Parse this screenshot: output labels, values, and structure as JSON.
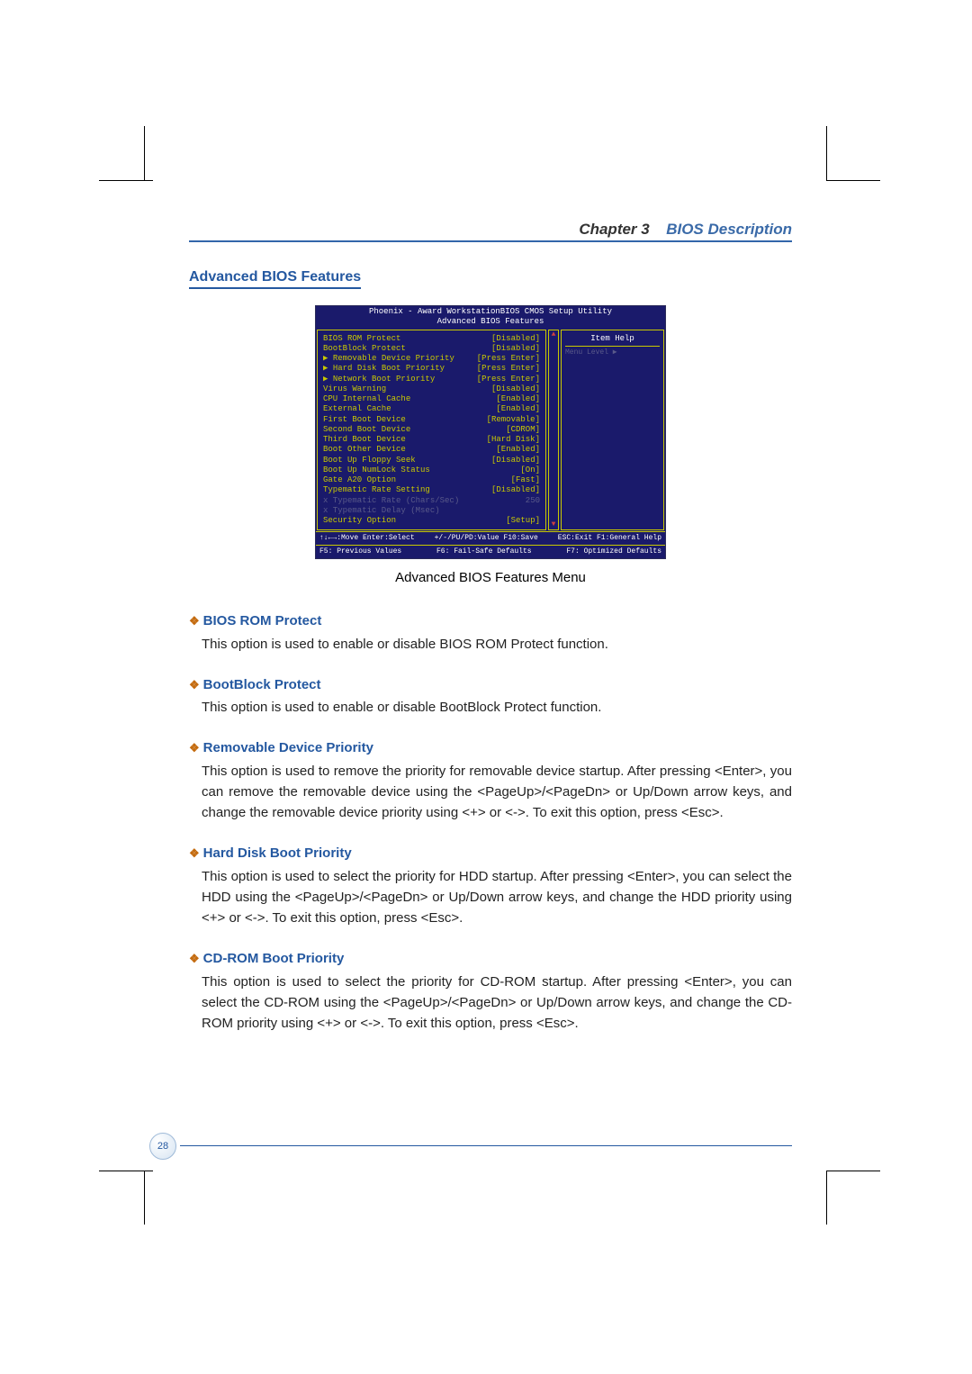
{
  "header": {
    "chapter": "Chapter 3",
    "title": "BIOS Description"
  },
  "section_title": "Advanced BIOS Features",
  "bios": {
    "title1": "Phoenix - Award WorkstationBIOS CMOS Setup Utility",
    "title2": "Advanced BIOS Features",
    "rows": [
      {
        "label": "BIOS ROM Protect",
        "value": "[Disabled]",
        "dim": false
      },
      {
        "label": "BootBlock Protect",
        "value": "[Disabled]",
        "dim": false
      },
      {
        "label": "▶ Removable Device Priority",
        "value": "[Press Enter]",
        "dim": false
      },
      {
        "label": "▶ Hard Disk Boot Priority",
        "value": "[Press Enter]",
        "dim": false
      },
      {
        "label": "▶ Network Boot Priority",
        "value": "[Press Enter]",
        "dim": false
      },
      {
        "label": "Virus Warning",
        "value": "[Disabled]",
        "dim": false
      },
      {
        "label": "CPU Internal Cache",
        "value": "[Enabled]",
        "dim": false
      },
      {
        "label": "External Cache",
        "value": "[Enabled]",
        "dim": false
      },
      {
        "label": "First Boot Device",
        "value": "[Removable]",
        "dim": false
      },
      {
        "label": "Second Boot Device",
        "value": "[CDROM]",
        "dim": false
      },
      {
        "label": "Third Boot Device",
        "value": "[Hard Disk]",
        "dim": false
      },
      {
        "label": "Boot Other Device",
        "value": "[Enabled]",
        "dim": false
      },
      {
        "label": "Boot Up Floppy Seek",
        "value": "[Disabled]",
        "dim": false
      },
      {
        "label": "Boot Up NumLock Status",
        "value": "[On]",
        "dim": false
      },
      {
        "label": "Gate A20 Option",
        "value": "[Fast]",
        "dim": false
      },
      {
        "label": "Typematic Rate Setting",
        "value": "[Disabled]",
        "dim": false
      },
      {
        "label": "x Typematic Rate (Chars/Sec)",
        "value": "250",
        "dim": true
      },
      {
        "label": "x Typematic Delay (Msec)",
        "value": "",
        "dim": true
      },
      {
        "label": "Security Option",
        "value": "[Setup]",
        "dim": false
      }
    ],
    "item_help": "Item Help",
    "menu_level": "Menu Level   ▶",
    "foot_left1": "↑↓←→:Move  Enter:Select",
    "foot_mid1": "+/-/PU/PD:Value  F10:Save",
    "foot_right1": "ESC:Exit  F1:General Help",
    "foot_left2": "F5: Previous Values",
    "foot_mid2": "F6: Fail-Safe Defaults",
    "foot_right2": "F7: Optimized Defaults"
  },
  "caption": "Advanced BIOS Features Menu",
  "items": [
    {
      "head": "BIOS ROM Protect",
      "body": "This option is used to enable or disable BIOS ROM Protect function."
    },
    {
      "head": "BootBlock Protect",
      "body": "This option is used to enable or disable BootBlock Protect function."
    },
    {
      "head": "Removable Device Priority",
      "body": "This option is used to remove the priority for removable device startup. After pressing <Enter>, you can remove the removable device using the <PageUp>/<PageDn> or Up/Down arrow keys, and change the removable device priority using <+> or <->. To exit this option, press <Esc>."
    },
    {
      "head": "Hard Disk Boot Priority",
      "body": "This option is used to select the priority for HDD startup. After pressing <Enter>, you can select the HDD using the <PageUp>/<PageDn> or Up/Down arrow keys, and change the HDD priority using <+> or <->. To exit this option, press <Esc>."
    },
    {
      "head": "CD-ROM Boot Priority",
      "body": "This option is used to select the priority for CD-ROM startup. After pressing <Enter>, you can select the CD-ROM using the <PageUp>/<PageDn> or Up/Down arrow keys, and change the CD-ROM priority using <+> or <->. To exit this option, press <Esc>."
    }
  ],
  "page_number": "28"
}
